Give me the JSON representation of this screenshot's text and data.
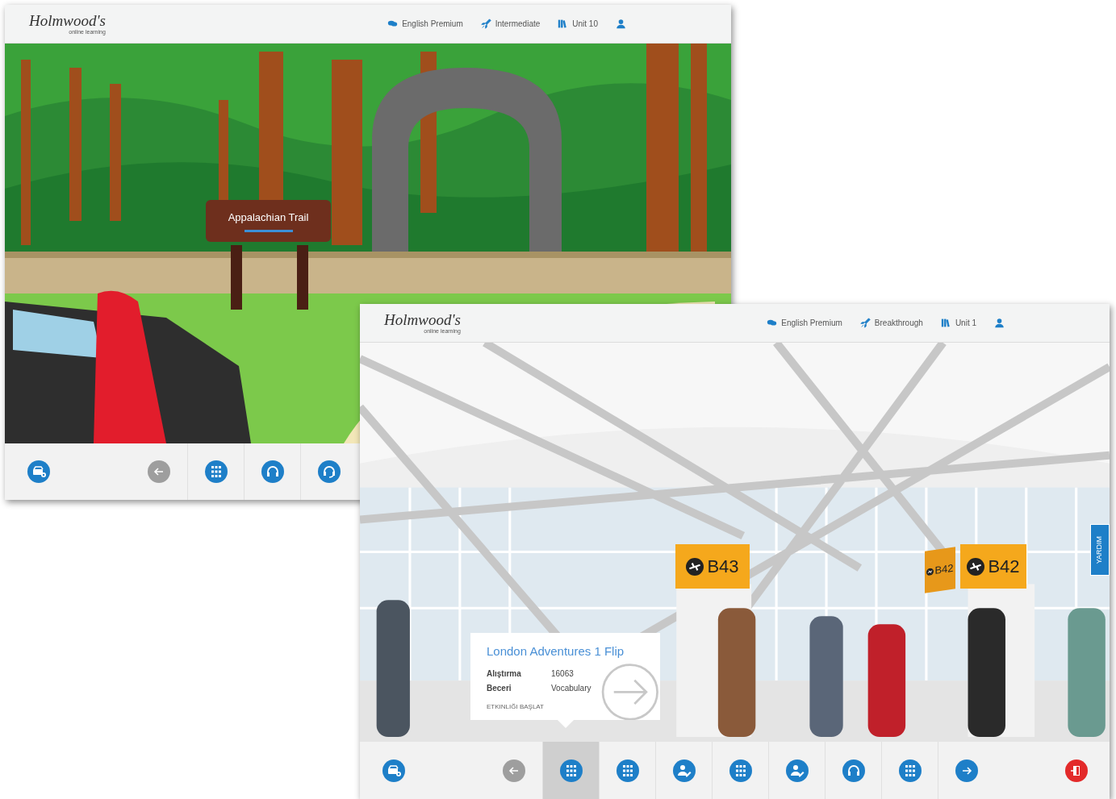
{
  "windows": [
    {
      "header": {
        "logo": {
          "name": "Holmwood's",
          "tagline": "online learning"
        },
        "nav": [
          {
            "kind": "course",
            "label": "English Premium"
          },
          {
            "kind": "level",
            "label": "Intermediate"
          },
          {
            "kind": "unit",
            "label": "Unit 10"
          },
          {
            "kind": "user"
          }
        ]
      },
      "scene": {
        "kind": "forest",
        "signs": [
          {
            "text": "Appalachian Trail"
          }
        ]
      },
      "toolbar": [
        {
          "kind": "basket",
          "selected": false
        },
        {
          "kind": "back",
          "selected": false
        },
        {
          "kind": "grid",
          "selected": false
        },
        {
          "kind": "headphones",
          "selected": false
        },
        {
          "kind": "headset",
          "selected": false
        }
      ]
    },
    {
      "header": {
        "logo": {
          "name": "Holmwood's",
          "tagline": "online learning"
        },
        "nav": [
          {
            "kind": "course",
            "label": "English Premium"
          },
          {
            "kind": "level",
            "label": "Breakthrough"
          },
          {
            "kind": "unit",
            "label": "Unit 1"
          },
          {
            "kind": "user"
          }
        ]
      },
      "scene": {
        "kind": "airport",
        "signs": [
          {
            "text": "B43"
          },
          {
            "text": "B42"
          },
          {
            "text": "B42"
          }
        ],
        "help_tab": "YARDIM",
        "popup": {
          "title": "London Adventures 1 Flip",
          "rows": [
            {
              "label": "Alıştırma",
              "value": "16063"
            },
            {
              "label": "Beceri",
              "value": "Vocabulary"
            }
          ],
          "link": "ETKINLIĞI BAŞLAT"
        }
      },
      "toolbar": [
        {
          "kind": "basket",
          "selected": false
        },
        {
          "kind": "back",
          "selected": false
        },
        {
          "kind": "grid",
          "selected": true
        },
        {
          "kind": "grid",
          "selected": false
        },
        {
          "kind": "person_edit",
          "selected": false
        },
        {
          "kind": "grid",
          "selected": false
        },
        {
          "kind": "person_edit",
          "selected": false
        },
        {
          "kind": "headphones",
          "selected": false
        },
        {
          "kind": "grid",
          "selected": false
        },
        {
          "kind": "next",
          "selected": false
        },
        {
          "kind": "exit",
          "selected": false
        }
      ]
    }
  ]
}
